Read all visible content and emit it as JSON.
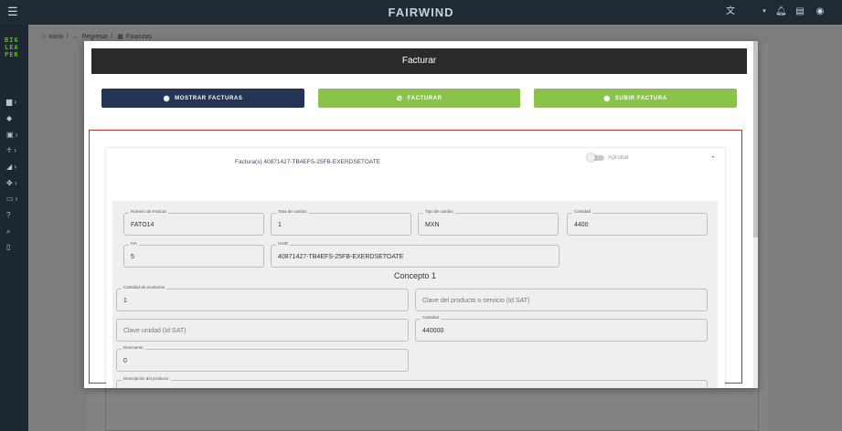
{
  "app": {
    "brand": "FAIRWIND",
    "logo_lines": [
      "BIG",
      "LEA",
      "PER"
    ]
  },
  "topbar_icons": [
    "menu-icon",
    "translate-icon",
    "chevron-down-icon",
    "bell-icon",
    "message-icon",
    "account-icon"
  ],
  "sidebar_icons": [
    "document-icon",
    "tag-icon",
    "chart-icon",
    "walk-icon",
    "road-icon",
    "puzzle-icon",
    "card-icon",
    "help-icon",
    "search-icon",
    "map-icon"
  ],
  "breadcrumb": {
    "home": "Inicio",
    "back": "Regresar",
    "current": "Finanzas"
  },
  "modal": {
    "title": "Facturar",
    "buttons": {
      "show_invoices": "MOSTRAR FACTURAS",
      "invoice": "FACTURAR",
      "upload_invoice": "SUBIR FACTURA"
    },
    "panel": {
      "title": "Factura(s) 40871427-TB4EFS-25FB-EXERDSETOATE",
      "toggle_label": "Aprobar",
      "fields": {
        "invoice_number": {
          "label": "Número de Factura",
          "value": "FATO14"
        },
        "exchange_rate": {
          "label": "Tasa de cambio",
          "value": "1"
        },
        "currency_type": {
          "label": "Tipo de cambio",
          "value": "MXN"
        },
        "amount": {
          "label": "Cantidad",
          "value": "4400"
        },
        "iva": {
          "label": "IVA",
          "value": "5"
        },
        "uuid": {
          "label": "UUID",
          "value": "40871427-TB4EFS-25FB-EXERDSETOATE"
        }
      },
      "concept": {
        "title": "Concepto 1",
        "product_qty": {
          "label": "Cantidad de productos",
          "value": "1"
        },
        "product_key": {
          "placeholder": "Clave del producto o servicio (Id SAT)"
        },
        "unit_key": {
          "placeholder": "Clave unidad (Id SAT)"
        },
        "qty": {
          "label": "Cantidad",
          "value": "440000"
        },
        "discount": {
          "label": "Descuento",
          "value": "0"
        },
        "description": {
          "label": "Descripción del producto"
        }
      }
    }
  },
  "colors": {
    "topbar": "#202a35",
    "sidebar": "#1d2731",
    "logo_green": "#55c21b",
    "primary_dark": "#243454",
    "accent_green": "#8bc34a",
    "outline_red": "#b3363c"
  }
}
